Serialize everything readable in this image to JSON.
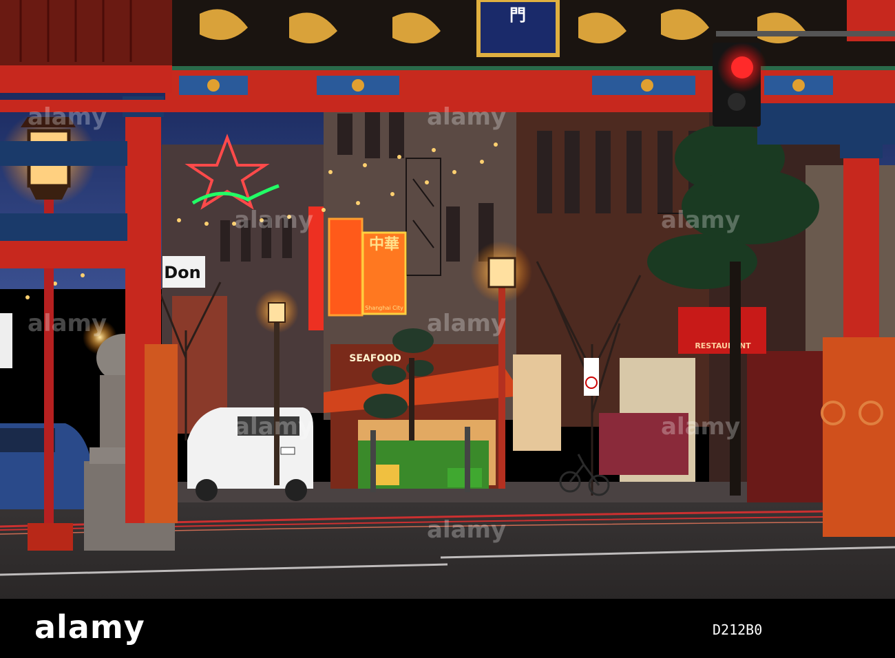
{
  "photo": {
    "gate_plaque": "門",
    "signs": {
      "left_sign": "Don",
      "seafood": "SEAFOOD",
      "restaurant_chinese": "中華",
      "restaurant_name": "Shanghai City",
      "right_restaurant": "RESTAURANT"
    },
    "colors": {
      "sky": "#1e2f6b",
      "gate_red": "#c7281e",
      "gate_gold": "#d9a23a",
      "night_glow": "#ff8a2a"
    }
  },
  "watermark": {
    "text": "alamy"
  },
  "banner": {
    "logo": "alamy",
    "image_id": "D212B0"
  }
}
